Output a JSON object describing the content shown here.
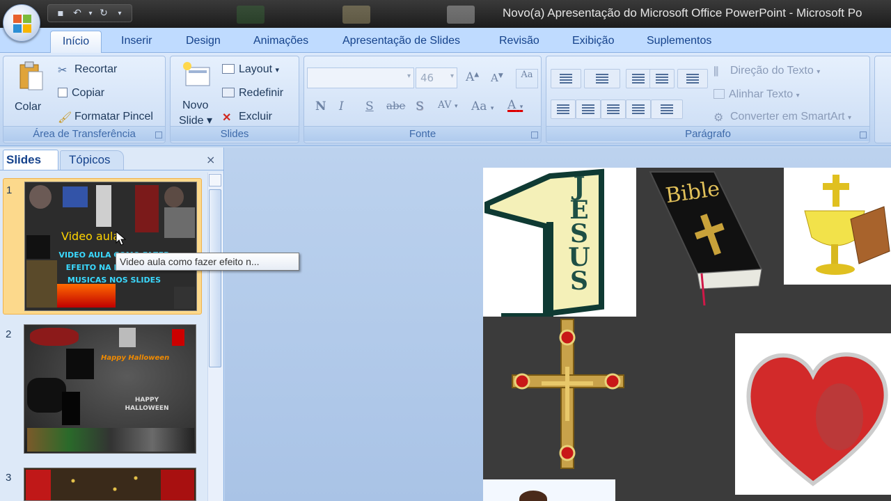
{
  "window": {
    "title": "Novo(a) Apresentação do Microsoft Office PowerPoint - Microsoft Po"
  },
  "ribbon": {
    "tabs": [
      "Início",
      "Inserir",
      "Design",
      "Animações",
      "Apresentação de Slides",
      "Revisão",
      "Exibição",
      "Suplementos"
    ],
    "active_tab": "Início",
    "clipboard": {
      "paste": "Colar",
      "cut": "Recortar",
      "copy": "Copiar",
      "format_painter": "Formatar Pincel",
      "label": "Área de Transferência"
    },
    "slides": {
      "new_slide_line1": "Novo",
      "new_slide_line2": "Slide",
      "layout": "Layout",
      "reset": "Redefinir",
      "delete": "Excluir",
      "label": "Slides"
    },
    "font": {
      "size": "46",
      "bold": "N",
      "italic": "I",
      "underline": "S",
      "strike": "abe",
      "shadow": "S",
      "spacing": "AV",
      "case": "Aa",
      "color": "A",
      "label": "Fonte"
    },
    "paragraph": {
      "text_direction": "Direção do Texto",
      "align_text": "Alinhar Texto",
      "smartart": "Converter em SmartArt",
      "label": "Parágrafo"
    }
  },
  "panel": {
    "tabs": [
      "Slides",
      "Tópicos"
    ],
    "close": "×",
    "slides": [
      {
        "number": "1",
        "title_text": "Video aula",
        "body_text": "VIDEO AULA COMO FAZER EFEITO NA E COLOCAR MUSICAS NOS SLIDES"
      },
      {
        "number": "2",
        "title_text": "Happy Halloween",
        "body_text": "HAPPY HALLOWEEN"
      },
      {
        "number": "3",
        "title_text": "",
        "body_text": ""
      }
    ],
    "tooltip": "Video aula como fazer efeito n..."
  },
  "slide_canvas": {
    "items": [
      "1 JESUS",
      "Bible",
      "chalice-bread",
      "crucifix",
      "heart-jesus"
    ],
    "bible_text": "Bible",
    "jesus_text": "JESUS"
  },
  "colors": {
    "ribbon_bg": "#dce9fb",
    "selected_slide": "#fcd98c",
    "tab_text": "#15428b",
    "slide_bg": "#3b3b3b"
  }
}
